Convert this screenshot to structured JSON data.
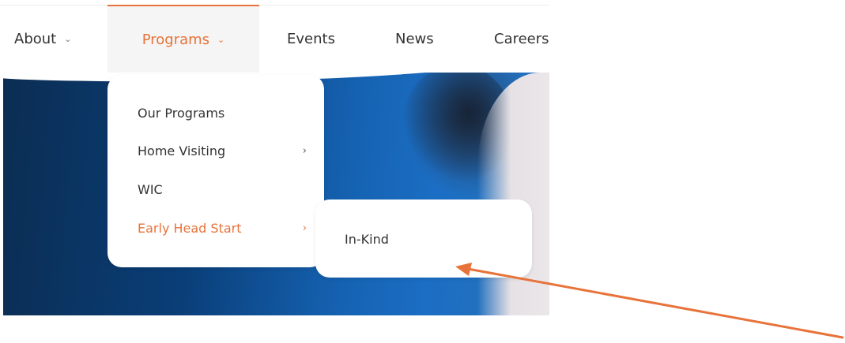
{
  "nav": {
    "items": [
      {
        "label": "About",
        "chevron": "⌄",
        "active": false
      },
      {
        "label": "Programs",
        "chevron": "⌄",
        "active": true
      },
      {
        "label": "Events",
        "active": false
      },
      {
        "label": "News",
        "active": false
      },
      {
        "label": "Careers",
        "active": false
      }
    ]
  },
  "dropdown": {
    "items": [
      {
        "label": "Our Programs",
        "has_submenu": false
      },
      {
        "label": "Home Visiting",
        "has_submenu": true,
        "arrow": "›"
      },
      {
        "label": "WIC",
        "has_submenu": false
      },
      {
        "label": "Early Head Start",
        "has_submenu": true,
        "arrow": "›",
        "active": true
      }
    ]
  },
  "submenu": {
    "items": [
      {
        "label": "In-Kind"
      }
    ]
  },
  "colors": {
    "accent": "#e8733a",
    "text": "#333333",
    "annotation_arrow": "#e8733a"
  },
  "icons": {
    "nav_chevron": "chevron-down-icon",
    "menu_arrow": "chevron-right-icon",
    "annotation": "arrow-icon"
  }
}
